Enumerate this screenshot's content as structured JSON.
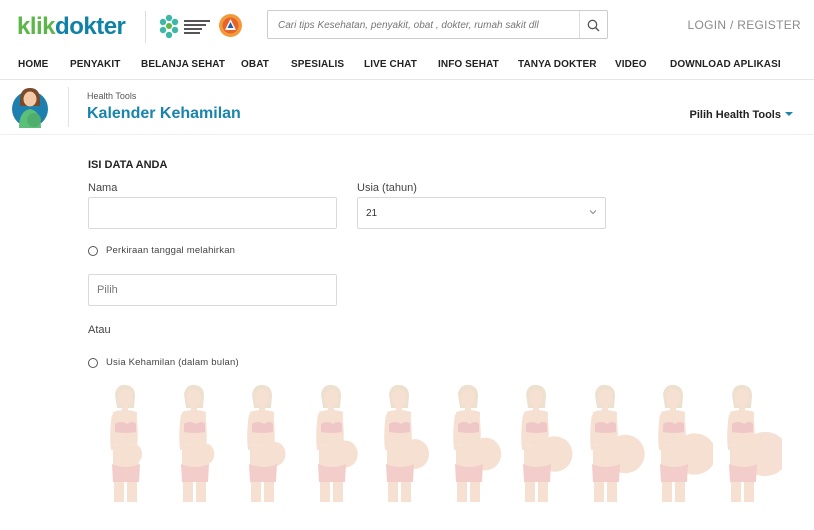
{
  "header": {
    "logo_part1": "klik",
    "logo_part2": "dokter",
    "search_placeholder": "Cari tips Kesehatan, penyakit, obat , dokter, rumah sakit dll",
    "login_label": "LOGIN / REGISTER"
  },
  "nav": [
    {
      "label": "HOME"
    },
    {
      "label": "PENYAKIT"
    },
    {
      "label": "BELANJA SEHAT"
    },
    {
      "label": "OBAT"
    },
    {
      "label": "SPESIALIS"
    },
    {
      "label": "LIVE CHAT"
    },
    {
      "label": "INFO SEHAT"
    },
    {
      "label": "TANYA DOKTER"
    },
    {
      "label": "VIDEO"
    },
    {
      "label": "DOWNLOAD APLIKASI"
    }
  ],
  "tool": {
    "breadcrumb": "Health Tools",
    "title": "Kalender Kehamilan",
    "picker_label": "Pilih Health Tools"
  },
  "form": {
    "section_title": "ISI DATA ANDA",
    "name_label": "Nama",
    "name_value": "",
    "age_label": "Usia (tahun)",
    "age_value": "21",
    "due_date_radio_label": "Perkiraan tanggal melahirkan",
    "due_date_placeholder": "Pilih",
    "or_label": "Atau",
    "months_radio_label": "Usia Kehamilan (dalam bulan)"
  },
  "colors": {
    "brand_green": "#5db64a",
    "brand_blue": "#0f82a6",
    "title_blue": "#1a84ad"
  },
  "icons": {
    "search": "search-icon",
    "dropdown": "caret-down-icon",
    "select": "chevron-down-icon"
  },
  "pregnancy_stages": [
    1,
    2,
    3,
    4,
    5,
    6,
    7,
    8,
    9,
    10
  ]
}
